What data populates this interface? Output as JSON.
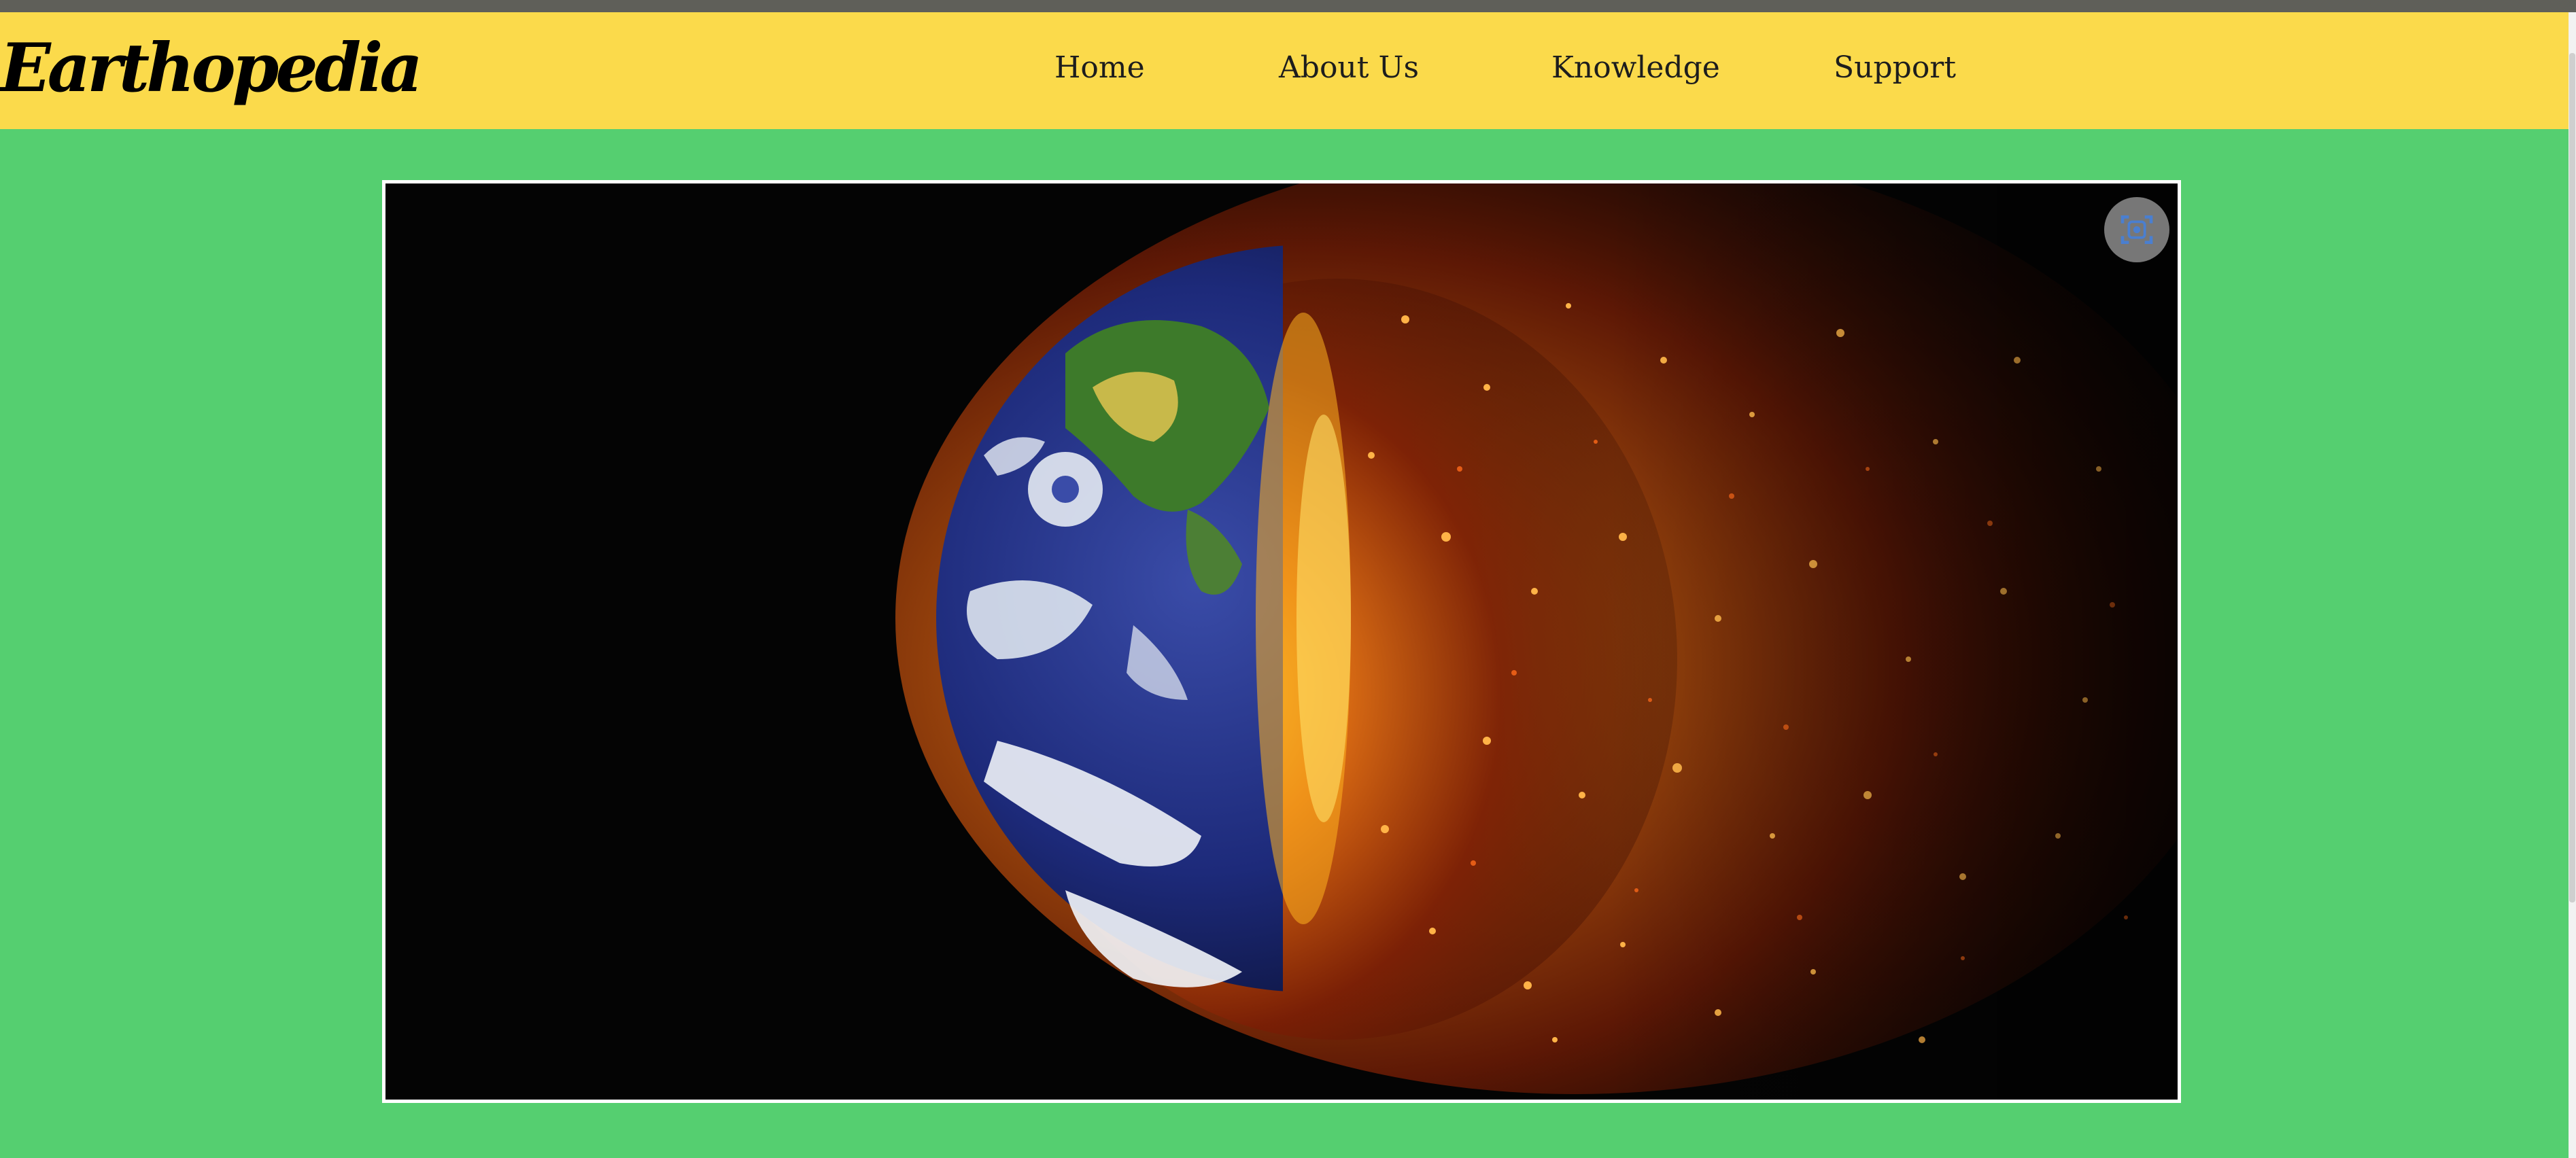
{
  "site": {
    "logo": "Earthopedia"
  },
  "nav": {
    "items": [
      {
        "label": "Home"
      },
      {
        "label": "About Us"
      },
      {
        "label": "Knowledge"
      },
      {
        "label": "Support"
      }
    ]
  },
  "hero": {
    "action_icon": "focus-scan-icon"
  },
  "colors": {
    "header_bg": "#fbda4b",
    "page_bg": "#55cf70",
    "topbar": "#5f5f59",
    "text": "#1d1d1d"
  }
}
